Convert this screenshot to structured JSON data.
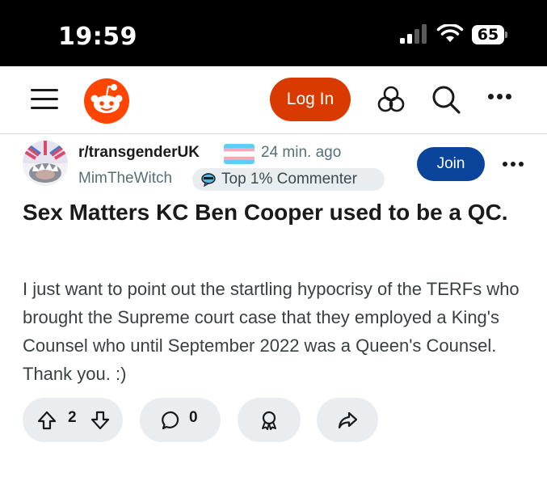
{
  "status_bar": {
    "time": "19:59",
    "battery": "65",
    "icons": [
      "cellular-signal-icon",
      "wifi-icon",
      "battery-icon"
    ]
  },
  "nav": {
    "login_label": "Log In",
    "icons": [
      "hamburger-menu-icon",
      "reddit-logo",
      "games-icon",
      "search-icon",
      "more-options-icon"
    ],
    "login_color": "#d93a00"
  },
  "post": {
    "subreddit": "r/transgenderUK",
    "time": "24 min. ago",
    "author": "MimTheWitch",
    "badge": "Top 1% Commenter",
    "join_label": "Join",
    "join_color": "#0a449b",
    "title": "Sex Matters KC Ben Cooper used to be a QC.",
    "body": "I just want to point out the startling hypocrisy of the TERFs who brought the Supreme court case that they employed a King's Counsel who until September 2022 was a Queen's Counsel. Thank you. :)",
    "flag_colors": [
      "#5bcefa",
      "#f5a9b8",
      "#ffffff",
      "#f5a9b8",
      "#5bcefa"
    ]
  },
  "actions": {
    "votes": "2",
    "comments": "0",
    "icons": [
      "upvote-icon",
      "downvote-icon",
      "comment-icon",
      "award-icon",
      "share-icon"
    ]
  }
}
